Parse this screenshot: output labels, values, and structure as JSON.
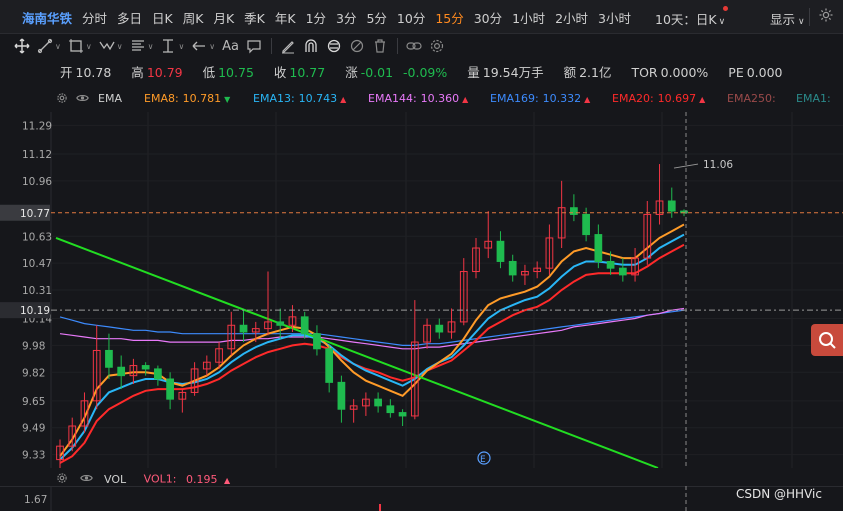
{
  "topbar": {
    "stock_name": "海南华铁",
    "periods": [
      {
        "label": "分时",
        "active": false
      },
      {
        "label": "多日",
        "active": false
      },
      {
        "label": "日K",
        "active": false
      },
      {
        "label": "周K",
        "active": false
      },
      {
        "label": "月K",
        "active": false
      },
      {
        "label": "季K",
        "active": false
      },
      {
        "label": "年K",
        "active": false
      },
      {
        "label": "1分",
        "active": false
      },
      {
        "label": "3分",
        "active": false
      },
      {
        "label": "5分",
        "active": false
      },
      {
        "label": "10分",
        "active": false
      },
      {
        "label": "15分",
        "active": true
      },
      {
        "label": "30分",
        "active": false
      },
      {
        "label": "1小时",
        "active": false
      },
      {
        "label": "2小时",
        "active": false
      },
      {
        "label": "3小时",
        "active": false
      }
    ],
    "range_select": "10天：日K",
    "display_menu": "显示",
    "active_color": "#ff8a1f",
    "stock_color": "#5aa0ff"
  },
  "toolbar": {
    "tools": [
      "move-icon",
      "line-tool-icon",
      "rect-tool-icon",
      "wave-tool-icon",
      "fib-tool-icon",
      "measure-tool-icon",
      "arrow-tool-icon",
      "text-tool-icon",
      "comment-tool-icon",
      "pen-icon",
      "magnet-icon",
      "sync-icon",
      "hide-icon",
      "delete-icon",
      "link-icon",
      "settings-icon"
    ],
    "text_tool_label": "Aa"
  },
  "quote": {
    "open_label": "开",
    "open": "10.78",
    "high_label": "高",
    "high": "10.79",
    "low_label": "低",
    "low": "10.75",
    "close_label": "收",
    "close": "10.77",
    "change_label": "涨",
    "change": "-0.01",
    "change_pct": "-0.09%",
    "volume_label": "量",
    "volume": "19.54万手",
    "amount_label": "额",
    "amount": "2.1亿",
    "tor_label": "TOR",
    "tor": "0.000%",
    "pe_label": "PE",
    "pe": "0.000"
  },
  "ema_legend": {
    "title": "EMA",
    "items": [
      {
        "label": "EMA8:",
        "value": "10.781",
        "dir": "down",
        "color": "#ff9b28"
      },
      {
        "label": "EMA13:",
        "value": "10.743",
        "dir": "up",
        "color": "#29b6f6"
      },
      {
        "label": "EMA144:",
        "value": "10.360",
        "dir": "up",
        "color": "#e879f9"
      },
      {
        "label": "EMA169:",
        "value": "10.332",
        "dir": "up",
        "color": "#3d8bfd"
      },
      {
        "label": "EMA20:",
        "value": "10.697",
        "dir": "up",
        "color": "#ff2a2a"
      },
      {
        "label": "EMA250:",
        "value": "",
        "dir": "none",
        "color": "#9a4a4a"
      },
      {
        "label": "EMA1:",
        "value": "",
        "dir": "none",
        "color": "#2a8a8a"
      }
    ]
  },
  "volume_header": {
    "title": "VOL",
    "vol1_label": "VOL1:",
    "vol1_value": "0.195",
    "vol1_color": "#ff5a7a"
  },
  "price_axis": {
    "ticks": [
      "11.29",
      "11.12",
      "10.96",
      "10.77",
      "10.63",
      "10.47",
      "10.31",
      "10.19",
      "10.14",
      "9.98",
      "9.82",
      "9.65",
      "9.49",
      "9.33"
    ],
    "current_price": "10.77",
    "ref_price": "10.19",
    "last_high": "11.06"
  },
  "volume_axis": {
    "ticks": [
      "1.67"
    ]
  },
  "chart_data": {
    "type": "candlestick",
    "ylim": [
      9.25,
      11.37
    ],
    "current_price": 10.77,
    "reference_price": 10.19,
    "annotated_high": 11.06,
    "candles": [
      {
        "o": 9.3,
        "h": 9.42,
        "l": 9.25,
        "c": 9.38
      },
      {
        "o": 9.38,
        "h": 9.55,
        "l": 9.35,
        "c": 9.5
      },
      {
        "o": 9.5,
        "h": 9.7,
        "l": 9.46,
        "c": 9.65
      },
      {
        "o": 9.65,
        "h": 10.1,
        "l": 9.6,
        "c": 9.95
      },
      {
        "o": 9.95,
        "h": 10.05,
        "l": 9.78,
        "c": 9.85
      },
      {
        "o": 9.85,
        "h": 9.92,
        "l": 9.72,
        "c": 9.8
      },
      {
        "o": 9.8,
        "h": 9.9,
        "l": 9.75,
        "c": 9.86
      },
      {
        "o": 9.86,
        "h": 9.88,
        "l": 9.8,
        "c": 9.84
      },
      {
        "o": 9.84,
        "h": 9.86,
        "l": 9.74,
        "c": 9.78
      },
      {
        "o": 9.78,
        "h": 9.82,
        "l": 9.6,
        "c": 9.66
      },
      {
        "o": 9.66,
        "h": 9.72,
        "l": 9.58,
        "c": 9.7
      },
      {
        "o": 9.7,
        "h": 9.88,
        "l": 9.68,
        "c": 9.84
      },
      {
        "o": 9.84,
        "h": 9.92,
        "l": 9.8,
        "c": 9.88
      },
      {
        "o": 9.88,
        "h": 10.0,
        "l": 9.84,
        "c": 9.96
      },
      {
        "o": 9.96,
        "h": 10.18,
        "l": 9.92,
        "c": 10.1
      },
      {
        "o": 10.1,
        "h": 10.2,
        "l": 10.0,
        "c": 10.06
      },
      {
        "o": 10.06,
        "h": 10.12,
        "l": 10.0,
        "c": 10.08
      },
      {
        "o": 10.08,
        "h": 10.42,
        "l": 10.04,
        "c": 10.12
      },
      {
        "o": 10.12,
        "h": 10.2,
        "l": 10.02,
        "c": 10.1
      },
      {
        "o": 10.1,
        "h": 10.22,
        "l": 10.06,
        "c": 10.15
      },
      {
        "o": 10.15,
        "h": 10.18,
        "l": 10.02,
        "c": 10.05
      },
      {
        "o": 10.05,
        "h": 10.1,
        "l": 9.92,
        "c": 9.96
      },
      {
        "o": 9.96,
        "h": 9.98,
        "l": 9.7,
        "c": 9.76
      },
      {
        "o": 9.76,
        "h": 9.8,
        "l": 9.52,
        "c": 9.6
      },
      {
        "o": 9.6,
        "h": 9.66,
        "l": 9.52,
        "c": 9.62
      },
      {
        "o": 9.62,
        "h": 9.7,
        "l": 9.56,
        "c": 9.66
      },
      {
        "o": 9.66,
        "h": 9.7,
        "l": 9.58,
        "c": 9.62
      },
      {
        "o": 9.62,
        "h": 9.66,
        "l": 9.55,
        "c": 9.58
      },
      {
        "o": 9.58,
        "h": 9.6,
        "l": 9.5,
        "c": 9.56
      },
      {
        "o": 9.56,
        "h": 10.25,
        "l": 9.54,
        "c": 10.0
      },
      {
        "o": 10.0,
        "h": 10.14,
        "l": 9.96,
        "c": 10.1
      },
      {
        "o": 10.1,
        "h": 10.14,
        "l": 10.02,
        "c": 10.06
      },
      {
        "o": 10.06,
        "h": 10.2,
        "l": 10.02,
        "c": 10.12
      },
      {
        "o": 10.12,
        "h": 10.5,
        "l": 10.1,
        "c": 10.42
      },
      {
        "o": 10.42,
        "h": 10.62,
        "l": 10.38,
        "c": 10.56
      },
      {
        "o": 10.56,
        "h": 10.78,
        "l": 10.5,
        "c": 10.6
      },
      {
        "o": 10.6,
        "h": 10.66,
        "l": 10.44,
        "c": 10.48
      },
      {
        "o": 10.48,
        "h": 10.52,
        "l": 10.36,
        "c": 10.4
      },
      {
        "o": 10.4,
        "h": 10.46,
        "l": 10.34,
        "c": 10.42
      },
      {
        "o": 10.42,
        "h": 10.48,
        "l": 10.38,
        "c": 10.44
      },
      {
        "o": 10.44,
        "h": 10.7,
        "l": 10.4,
        "c": 10.62
      },
      {
        "o": 10.62,
        "h": 10.96,
        "l": 10.56,
        "c": 10.8
      },
      {
        "o": 10.8,
        "h": 10.88,
        "l": 10.72,
        "c": 10.76
      },
      {
        "o": 10.76,
        "h": 10.8,
        "l": 10.6,
        "c": 10.64
      },
      {
        "o": 10.64,
        "h": 10.7,
        "l": 10.44,
        "c": 10.48
      },
      {
        "o": 10.48,
        "h": 10.54,
        "l": 10.4,
        "c": 10.44
      },
      {
        "o": 10.44,
        "h": 10.5,
        "l": 10.36,
        "c": 10.4
      },
      {
        "o": 10.4,
        "h": 10.56,
        "l": 10.36,
        "c": 10.5
      },
      {
        "o": 10.5,
        "h": 10.84,
        "l": 10.46,
        "c": 10.76
      },
      {
        "o": 10.76,
        "h": 11.06,
        "l": 10.7,
        "c": 10.84
      },
      {
        "o": 10.84,
        "h": 10.92,
        "l": 10.74,
        "c": 10.78
      },
      {
        "o": 10.78,
        "h": 10.79,
        "l": 10.75,
        "c": 10.77
      }
    ],
    "ema8": [
      9.32,
      9.42,
      9.55,
      9.72,
      9.8,
      9.81,
      9.82,
      9.82,
      9.81,
      9.76,
      9.74,
      9.77,
      9.8,
      9.85,
      9.92,
      9.98,
      10.02,
      10.05,
      10.07,
      10.09,
      10.08,
      10.04,
      9.97,
      9.89,
      9.82,
      9.77,
      9.74,
      9.71,
      9.68,
      9.75,
      9.83,
      9.88,
      9.93,
      10.02,
      10.13,
      10.22,
      10.26,
      10.28,
      10.3,
      10.33,
      10.39,
      10.48,
      10.54,
      10.56,
      10.54,
      10.52,
      10.5,
      10.5,
      10.56,
      10.62,
      10.66,
      10.7
    ],
    "ema13": [
      9.3,
      9.37,
      9.47,
      9.62,
      9.7,
      9.73,
      9.76,
      9.78,
      9.78,
      9.76,
      9.75,
      9.76,
      9.78,
      9.82,
      9.88,
      9.93,
      9.97,
      10.0,
      10.02,
      10.04,
      10.04,
      10.02,
      9.98,
      9.92,
      9.87,
      9.83,
      9.8,
      9.77,
      9.74,
      9.78,
      9.84,
      9.88,
      9.91,
      9.98,
      10.06,
      10.14,
      10.19,
      10.22,
      10.25,
      10.27,
      10.32,
      10.39,
      10.45,
      10.48,
      10.48,
      10.47,
      10.46,
      10.46,
      10.5,
      10.56,
      10.6,
      10.64
    ],
    "ema20": [
      9.28,
      9.32,
      9.4,
      9.53,
      9.6,
      9.64,
      9.68,
      9.71,
      9.72,
      9.72,
      9.72,
      9.73,
      9.75,
      9.78,
      9.83,
      9.87,
      9.91,
      9.94,
      9.96,
      9.98,
      9.99,
      9.98,
      9.96,
      9.91,
      9.87,
      9.84,
      9.82,
      9.79,
      9.77,
      9.79,
      9.83,
      9.86,
      9.89,
      9.95,
      10.01,
      10.08,
      10.12,
      10.16,
      10.19,
      10.21,
      10.25,
      10.31,
      10.36,
      10.4,
      10.41,
      10.41,
      10.41,
      10.41,
      10.45,
      10.5,
      10.54,
      10.58
    ],
    "ema144": [
      10.05,
      10.04,
      10.03,
      10.02,
      10.02,
      10.02,
      10.01,
      10.01,
      10.01,
      10.0,
      10.0,
      10.0,
      10.0,
      10.0,
      10.01,
      10.01,
      10.02,
      10.02,
      10.03,
      10.03,
      10.03,
      10.03,
      10.02,
      10.01,
      10.0,
      9.99,
      9.98,
      9.97,
      9.96,
      9.96,
      9.97,
      9.97,
      9.98,
      9.99,
      10.0,
      10.01,
      10.02,
      10.03,
      10.04,
      10.05,
      10.06,
      10.07,
      10.09,
      10.1,
      10.11,
      10.12,
      10.13,
      10.14,
      10.16,
      10.17,
      10.19,
      10.2
    ],
    "ema169": [
      10.15,
      10.13,
      10.11,
      10.1,
      10.09,
      10.08,
      10.07,
      10.07,
      10.06,
      10.06,
      10.05,
      10.05,
      10.05,
      10.05,
      10.05,
      10.05,
      10.05,
      10.05,
      10.05,
      10.05,
      10.05,
      10.05,
      10.04,
      10.03,
      10.02,
      10.01,
      10.0,
      9.99,
      9.98,
      9.98,
      9.99,
      9.99,
      10.0,
      10.01,
      10.02,
      10.03,
      10.04,
      10.05,
      10.06,
      10.07,
      10.08,
      10.09,
      10.1,
      10.11,
      10.12,
      10.13,
      10.14,
      10.15,
      10.16,
      10.17,
      10.18,
      10.19
    ],
    "trendline": {
      "start": 10.62,
      "end": 9.25
    }
  }
}
